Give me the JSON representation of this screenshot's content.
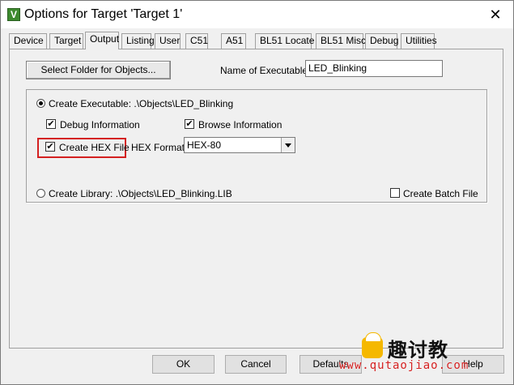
{
  "window": {
    "title": "Options for Target 'Target 1'",
    "icon_letter": "V",
    "close_glyph": "✕"
  },
  "tabs": [
    {
      "label": "Device"
    },
    {
      "label": "Target"
    },
    {
      "label": "Output",
      "active": true
    },
    {
      "label": "Listing"
    },
    {
      "label": "User"
    },
    {
      "label": "C51"
    },
    {
      "label": "A51"
    },
    {
      "label": "BL51 Locate"
    },
    {
      "label": "BL51 Misc"
    },
    {
      "label": "Debug"
    },
    {
      "label": "Utilities"
    }
  ],
  "output": {
    "select_folder_label": "Select Folder for Objects...",
    "name_of_executable_label": "Name of Executable:",
    "name_of_executable_value": "LED_Blinking",
    "create_executable_label": "Create Executable:  .\\Objects\\LED_Blinking",
    "create_executable_checked": true,
    "debug_information_label": "Debug Information",
    "debug_information_checked": true,
    "browse_information_label": "Browse Information",
    "browse_information_checked": true,
    "create_hex_label": "Create HEX File",
    "create_hex_checked": true,
    "hex_format_label": "HEX Format:",
    "hex_format_value": "HEX-80",
    "create_library_label": "Create Library:  .\\Objects\\LED_Blinking.LIB",
    "create_library_checked": false,
    "create_batch_label": "Create Batch File",
    "create_batch_checked": false,
    "check_glyph": "✔"
  },
  "footer": {
    "ok_label": "OK",
    "cancel_label": "Cancel",
    "defaults_label": "Defaults",
    "help_label": "Help"
  },
  "watermark": {
    "chinese_text": "趣讨教",
    "url": "www.qutaojiao.com"
  },
  "colors": {
    "highlight_box": "#d42020",
    "dialog_bg": "#f0f0f0",
    "watermark_url": "#d42020"
  }
}
